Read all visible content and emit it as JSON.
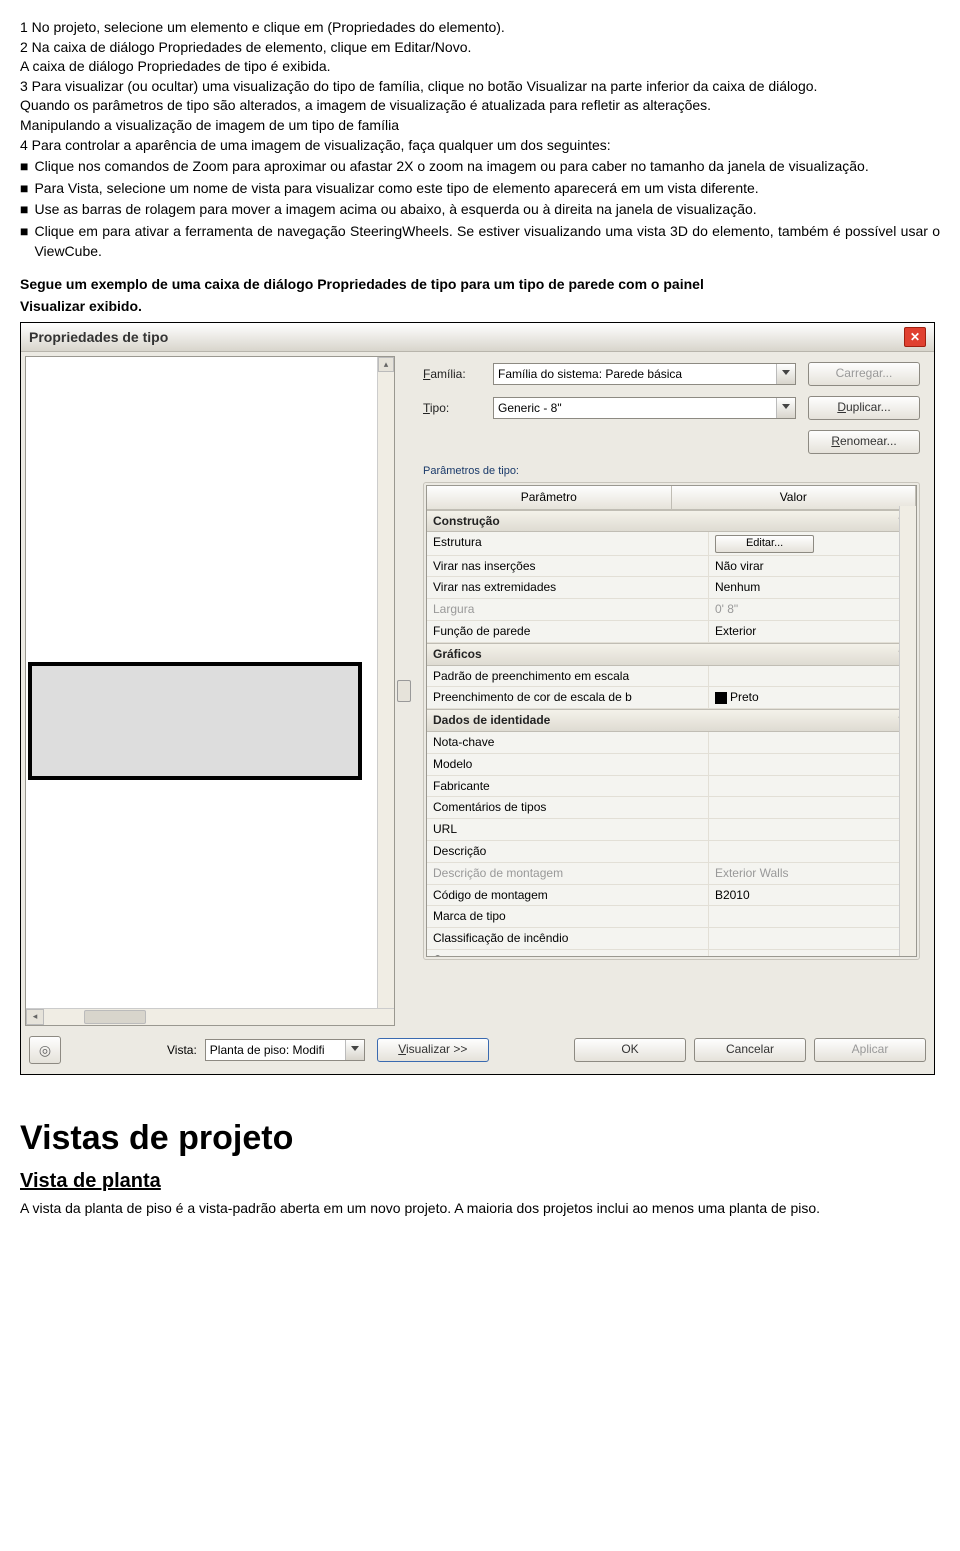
{
  "instructions": {
    "step1": "1 No projeto, selecione um elemento e clique em (Propriedades do elemento).",
    "step2": "2 Na caixa de diálogo Propriedades de elemento, clique em Editar/Novo.",
    "step2b": "A caixa de diálogo Propriedades de tipo é exibida.",
    "step3": "3 Para visualizar (ou ocultar) uma visualização do tipo de família, clique no botão Visualizar na parte inferior da caixa de diálogo.",
    "step3b": "Quando os parâmetros de tipo são alterados, a imagem de visualização é atualizada para refletir as alterações.",
    "manip_title": "Manipulando a visualização de imagem de um tipo de família",
    "step4": "4 Para controlar a aparência de uma imagem de visualização, faça qualquer um dos seguintes:",
    "b1": "Clique nos comandos de Zoom para aproximar ou afastar 2X o zoom na imagem ou para caber no tamanho da janela de visualização.",
    "b2": "Para Vista, selecione um nome de vista para visualizar como este tipo de elemento aparecerá em um vista diferente.",
    "b3": "Use as barras de rolagem para mover a imagem acima ou abaixo, à esquerda ou à direita na janela de visualização.",
    "b4": "Clique em para ativar a ferramenta de navegação SteeringWheels. Se estiver visualizando uma vista 3D do elemento, também é possível usar o ViewCube.",
    "example_p1": "Segue um exemplo de uma caixa de diálogo Propriedades de tipo para um tipo de parede com o painel",
    "example_p2": "Visualizar exibido."
  },
  "dialog": {
    "title": "Propriedades de tipo",
    "familia_label": "Família:",
    "familia_value": "Família do sistema: Parede básica",
    "tipo_label": "Tipo:",
    "tipo_value": "Generic - 8\"",
    "btn_carregar": "Carregar...",
    "btn_duplicar": "Duplicar...",
    "btn_renomear": "Renomear...",
    "group_label": "Parâmetros de tipo:",
    "col_param": "Parâmetro",
    "col_valor": "Valor",
    "sections": {
      "construcao": {
        "title": "Construção",
        "rows": [
          {
            "p": "Estrutura",
            "v": "__edit__",
            "edit_label": "Editar..."
          },
          {
            "p": "Virar nas inserções",
            "v": "Não virar"
          },
          {
            "p": "Virar nas extremidades",
            "v": "Nenhum"
          },
          {
            "p": "Largura",
            "v": "0' 8\"",
            "disabled": true
          },
          {
            "p": "Função de parede",
            "v": "Exterior"
          }
        ]
      },
      "graficos": {
        "title": "Gráficos",
        "rows": [
          {
            "p": "Padrão de preenchimento em escala",
            "v": ""
          },
          {
            "p": "Preenchimento de cor de escala de b",
            "v": "Preto",
            "swatch": true
          }
        ]
      },
      "identidade": {
        "title": "Dados de identidade",
        "rows": [
          {
            "p": "Nota-chave",
            "v": ""
          },
          {
            "p": "Modelo",
            "v": ""
          },
          {
            "p": "Fabricante",
            "v": ""
          },
          {
            "p": "Comentários de tipos",
            "v": ""
          },
          {
            "p": "URL",
            "v": ""
          },
          {
            "p": "Descrição",
            "v": ""
          },
          {
            "p": "Descrição de montagem",
            "v": "Exterior Walls",
            "disabled": true
          },
          {
            "p": "Código de montagem",
            "v": "B2010"
          },
          {
            "p": "Marca de tipo",
            "v": ""
          },
          {
            "p": "Classificação de incêndio",
            "v": ""
          },
          {
            "p": "Custo",
            "v": ""
          }
        ]
      }
    },
    "bottom": {
      "vista_label": "Vista:",
      "vista_value": "Planta de piso: Modifi",
      "btn_visualizar": "Visualizar >>",
      "btn_ok": "OK",
      "btn_cancelar": "Cancelar",
      "btn_aplicar": "Aplicar"
    }
  },
  "footer": {
    "h2": "Vistas de projeto",
    "sub": "Vista de planta",
    "text": "A vista da planta de piso é a vista-padrão aberta em um novo projeto. A maioria dos projetos inclui ao menos uma planta de piso."
  }
}
